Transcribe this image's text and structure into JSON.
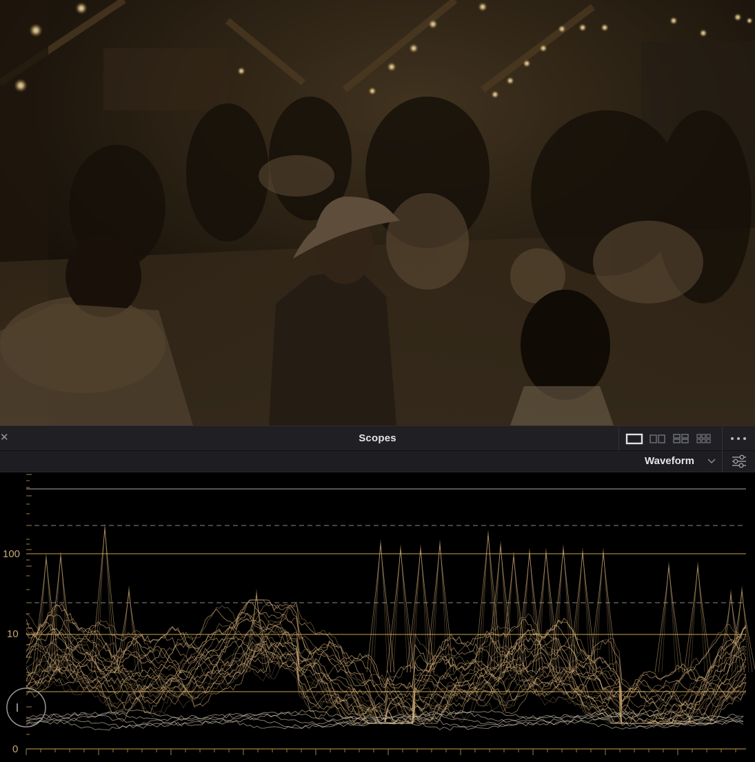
{
  "panel": {
    "title": "Scopes",
    "close_icon": "close-icon",
    "layout_icons": [
      "single-view-icon",
      "dual-view-icon",
      "quad-view-icon",
      "six-view-icon"
    ],
    "more_icon": "more-options-icon"
  },
  "toolbar": {
    "scope_type": "Waveform",
    "dropdown_icon": "chevron-down-icon",
    "settings_icon": "sliders-settings-icon"
  },
  "scope": {
    "levels": {
      "high": "100",
      "mid": "10",
      "low": "0"
    },
    "trace_color": "#d9b27a",
    "grid_color": "#a0823f",
    "zoom_icon": "zoom-circle-icon"
  },
  "viewer": {
    "description_icon": "video-frame"
  }
}
